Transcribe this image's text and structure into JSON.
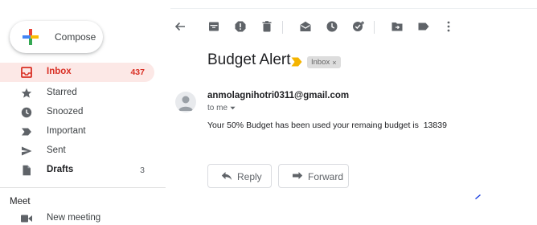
{
  "compose": {
    "label": "Compose"
  },
  "sidebar": {
    "items": [
      {
        "label": "Inbox",
        "count": "437",
        "icon": "inbox-icon"
      },
      {
        "label": "Starred",
        "count": "",
        "icon": "star-icon"
      },
      {
        "label": "Snoozed",
        "count": "",
        "icon": "clock-icon"
      },
      {
        "label": "Important",
        "count": "",
        "icon": "important-icon"
      },
      {
        "label": "Sent",
        "count": "",
        "icon": "send-icon"
      },
      {
        "label": "Drafts",
        "count": "3",
        "icon": "draft-icon"
      }
    ]
  },
  "meet": {
    "heading": "Meet",
    "new_meeting": "New meeting"
  },
  "toolbar": {
    "icons": [
      "back-arrow-icon",
      "archive-icon",
      "report-spam-icon",
      "delete-icon",
      "mark-unread-icon",
      "snooze-icon",
      "add-to-tasks-icon",
      "move-to-icon",
      "label-icon",
      "more-icon"
    ]
  },
  "email": {
    "subject": "Budget Alert",
    "label_chip": "Inbox",
    "label_close": "×",
    "sender": "anmolagnihotri0311@gmail.com",
    "recipient": "to me",
    "body": "Your 50% Budget has been used your remaing budget is  13839"
  },
  "actions": {
    "reply": "Reply",
    "forward": "Forward"
  },
  "colors": {
    "accent_red": "#d93025",
    "inbox_highlight": "#fce8e6",
    "important_marker": "#f4b400",
    "icon_gray": "#5f6368"
  }
}
